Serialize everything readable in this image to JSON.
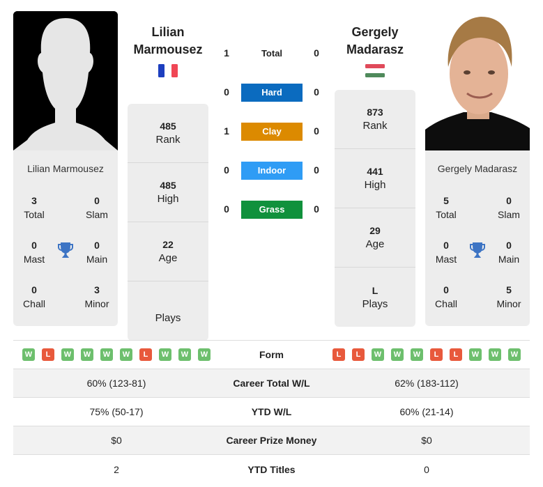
{
  "player1": {
    "name_line1": "Lilian",
    "name_line2": "Marmousez",
    "full_name": "Lilian Marmousez",
    "country_flag": "france-flag",
    "titles": {
      "total": {
        "value": "3",
        "label": "Total"
      },
      "slam": {
        "value": "0",
        "label": "Slam"
      },
      "mast": {
        "value": "0",
        "label": "Mast"
      },
      "main": {
        "value": "0",
        "label": "Main"
      },
      "chall": {
        "value": "0",
        "label": "Chall"
      },
      "minor": {
        "value": "3",
        "label": "Minor"
      }
    },
    "stats": [
      {
        "value": "485",
        "label": "Rank"
      },
      {
        "value": "485",
        "label": "High"
      },
      {
        "value": "22",
        "label": "Age"
      },
      {
        "value": "",
        "label": "Plays"
      }
    ],
    "form": [
      "W",
      "L",
      "W",
      "W",
      "W",
      "W",
      "L",
      "W",
      "W",
      "W"
    ]
  },
  "player2": {
    "name_line1": "Gergely",
    "name_line2": "Madarasz",
    "full_name": "Gergely Madarasz",
    "country_flag": "hungary-flag",
    "titles": {
      "total": {
        "value": "5",
        "label": "Total"
      },
      "slam": {
        "value": "0",
        "label": "Slam"
      },
      "mast": {
        "value": "0",
        "label": "Mast"
      },
      "main": {
        "value": "0",
        "label": "Main"
      },
      "chall": {
        "value": "0",
        "label": "Chall"
      },
      "minor": {
        "value": "5",
        "label": "Minor"
      }
    },
    "stats": [
      {
        "value": "873",
        "label": "Rank"
      },
      {
        "value": "441",
        "label": "High"
      },
      {
        "value": "29",
        "label": "Age"
      },
      {
        "value": "L",
        "label": "Plays"
      }
    ],
    "form": [
      "L",
      "L",
      "W",
      "W",
      "W",
      "L",
      "L",
      "W",
      "W",
      "W"
    ]
  },
  "h2h": [
    {
      "label": "Total",
      "left": "1",
      "right": "0",
      "color": ""
    },
    {
      "label": "Hard",
      "left": "0",
      "right": "0",
      "color": "#0b6bbf"
    },
    {
      "label": "Clay",
      "left": "1",
      "right": "0",
      "color": "#dc8a00"
    },
    {
      "label": "Indoor",
      "left": "0",
      "right": "0",
      "color": "#2f9cf5"
    },
    {
      "label": "Grass",
      "left": "0",
      "right": "0",
      "color": "#10913c"
    }
  ],
  "comparison": {
    "form_label": "Form",
    "rows": [
      {
        "label": "Career Total W/L",
        "left": "60% (123-81)",
        "right": "62% (183-112)"
      },
      {
        "label": "YTD W/L",
        "left": "75% (50-17)",
        "right": "60% (21-14)"
      },
      {
        "label": "Career Prize Money",
        "left": "$0",
        "right": "$0"
      },
      {
        "label": "YTD Titles",
        "left": "2",
        "right": "0"
      }
    ]
  },
  "colors": {
    "win": "#6dbf6d",
    "loss": "#e8593c",
    "trophy": "#3d74c4",
    "card_bg": "#ededed"
  }
}
